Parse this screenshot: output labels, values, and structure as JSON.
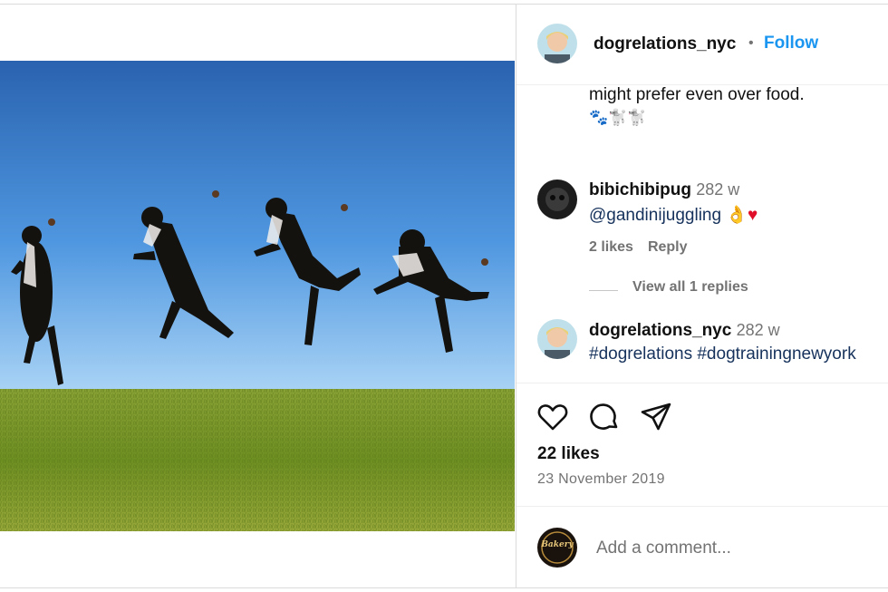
{
  "post": {
    "username": "dogrelations_nyc",
    "follow_label": "Follow",
    "caption_tail": "might prefer even over food.",
    "caption_emoji": "🐾🐩🐩"
  },
  "comments": [
    {
      "username": "bibichibipug",
      "time": "282 w",
      "text": "@gandinijuggling 👌",
      "heart": "♥",
      "likes": "2 likes",
      "reply_label": "Reply",
      "view_replies": "View all 1 replies"
    },
    {
      "username": "dogrelations_nyc",
      "time": "282 w",
      "text": "#dogrelations #dogtrainingnewyork"
    }
  ],
  "actions": {
    "like_icon": "heart-icon",
    "comment_icon": "comment-icon",
    "share_icon": "share-icon"
  },
  "likes_count": "22 likes",
  "date": "23 November 2019",
  "comment_box": {
    "placeholder": "Add a comment...",
    "avatar_text": "Bakery"
  },
  "colors": {
    "accent": "#1a95f0",
    "sky": "#3f8fe0",
    "grass": "#7b9a2c"
  }
}
